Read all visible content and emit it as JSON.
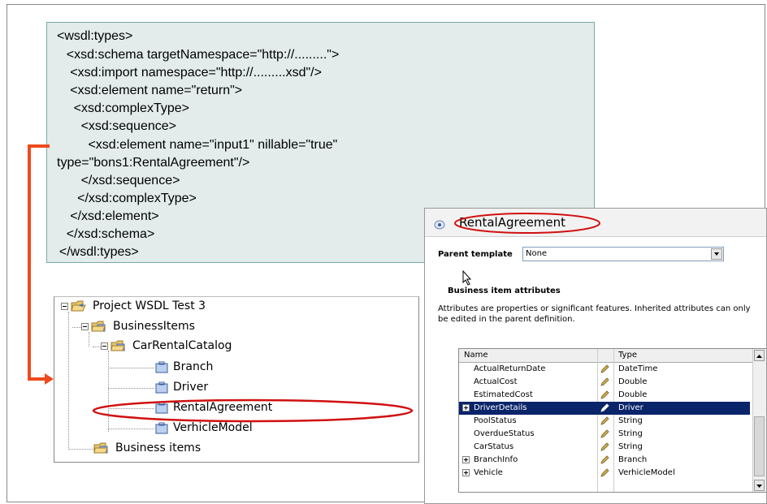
{
  "code": {
    "lines": [
      "<wsdl:types>",
      "    <xsd:schema targetNamespace=\"http://.........\">",
      "     <xsd:import namespace=\"http://.........xsd\"/>",
      "     <xsd:element name=\"return\">",
      "      <xsd:complexType>",
      "        <xsd:sequence>",
      "          <xsd:element name=\"input1\" nillable=\"true\"",
      "type=\"bons1:RentalAgreement\"/>",
      "        </xsd:sequence>",
      "       </xsd:complexType>",
      "     </xsd:element>",
      "    </xsd:schema>",
      "  </wsdl:types>"
    ]
  },
  "tree": {
    "project": "Project WSDL Test 3",
    "business_items_folder": "BusinessItems",
    "catalog": "CarRentalCatalog",
    "items": [
      "Branch",
      "Driver",
      "RentalAgreement",
      "VerhicleModel"
    ],
    "selected_item": "RentalAgreement",
    "business_items": "Business items"
  },
  "editor": {
    "title": "RentalAgreement",
    "parent_template_label": "Parent template",
    "parent_template_value": "None",
    "section_title": "Business item attributes",
    "description": "Attributes are properties or significant features. Inherited attributes can only be edited in the parent definition.",
    "description_line1": "Attributes are properties or significant features. Inherited attributes can only",
    "description_line2": "be edited in the parent definition.",
    "columns": {
      "name": "Name",
      "type": "Type"
    },
    "rows": [
      {
        "name": "ActualReturnDate",
        "type": "DateTime",
        "expandable": false,
        "selected": false
      },
      {
        "name": "ActualCost",
        "type": "Double",
        "expandable": false,
        "selected": false
      },
      {
        "name": "EstimatedCost",
        "type": "Double",
        "expandable": false,
        "selected": false
      },
      {
        "name": "DriverDetails",
        "type": "Driver",
        "expandable": true,
        "selected": true
      },
      {
        "name": "PoolStatus",
        "type": "String",
        "expandable": false,
        "selected": false
      },
      {
        "name": "OverdueStatus",
        "type": "String",
        "expandable": false,
        "selected": false
      },
      {
        "name": "CarStatus",
        "type": "String",
        "expandable": false,
        "selected": false
      },
      {
        "name": "BranchInfo",
        "type": "Branch",
        "expandable": true,
        "selected": false
      },
      {
        "name": "Vehicle",
        "type": "VerhicleModel",
        "expandable": true,
        "selected": false
      }
    ]
  },
  "colors": {
    "arrow": "#ee4a1d",
    "highlight_ellipse": "#d01010",
    "selection": "#0a246a",
    "code_bg": "#e3ebeb"
  }
}
